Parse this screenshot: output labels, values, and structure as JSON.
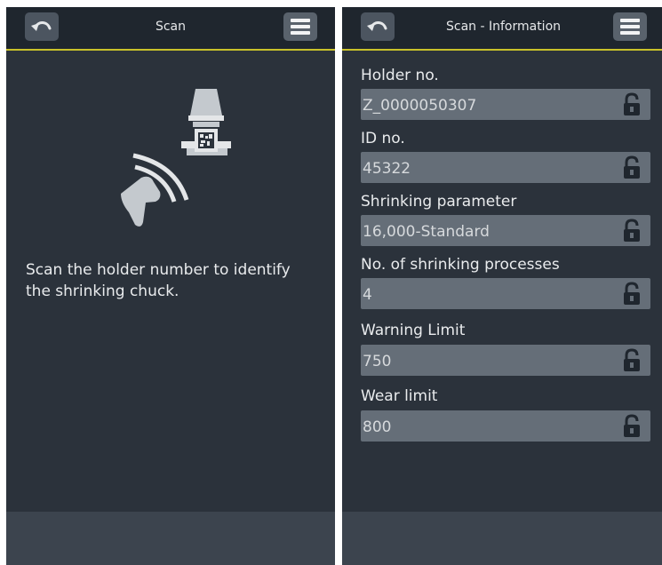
{
  "left_screen": {
    "title": "Scan",
    "instruction": "Scan the holder number to identify the shrinking chuck.",
    "icons": {
      "back": "undo-icon",
      "menu": "hamburger-menu-icon",
      "illustration": "barcode-scanner-icon"
    }
  },
  "right_screen": {
    "title": "Scan - Information",
    "fields": [
      {
        "label": "Holder no.",
        "value": "Z_0000050307"
      },
      {
        "label": "ID no.",
        "value": "45322"
      },
      {
        "label": "Shrinking parameter",
        "value": "16,000-Standard"
      },
      {
        "label": "No. of shrinking processes",
        "value": "4"
      },
      {
        "label": "Warning Limit",
        "value": "750"
      },
      {
        "label": "Wear limit",
        "value": "800"
      }
    ],
    "icons": {
      "back": "undo-icon",
      "menu": "hamburger-menu-icon",
      "field_lock": "lock-icon"
    }
  },
  "colors": {
    "panel_background": "#2b323b",
    "header_background": "#1f262e",
    "accent_line": "#c9c22a",
    "field_background": "#656e78",
    "footer_background": "#3c444e"
  }
}
